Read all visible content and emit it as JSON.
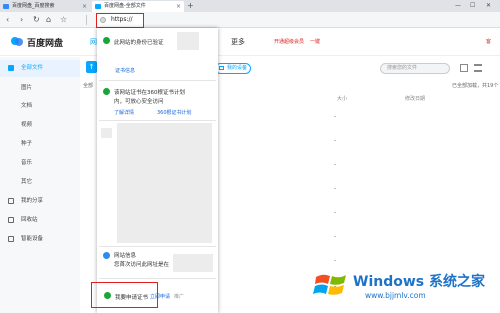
{
  "browser": {
    "tabs": [
      {
        "label": "百度网盘_百度搜索"
      },
      {
        "label": "百度网盘-全部文件"
      }
    ],
    "new_tab": "+",
    "address": "https://",
    "nav": {
      "back": "‹",
      "forward": "›",
      "refresh": "↻",
      "home": "⌂",
      "star": "☆"
    },
    "window_controls": {
      "minimize": "—",
      "maximize": "☐",
      "close": "✕"
    }
  },
  "app": {
    "logo_text": "百度网盘",
    "nav_first": "网",
    "nav_more": "更多",
    "promo": "开通超级会员",
    "promo2": "一键",
    "promo3": "客"
  },
  "sidebar": {
    "items": [
      {
        "label": "全部文件",
        "active": true
      },
      {
        "label": "图片"
      },
      {
        "label": "文档"
      },
      {
        "label": "视频"
      },
      {
        "label": "种子"
      },
      {
        "label": "音乐"
      },
      {
        "label": "其它"
      },
      {
        "label": "我的分享"
      },
      {
        "label": "回收站"
      },
      {
        "label": "智能设备"
      }
    ]
  },
  "toolbar": {
    "devices": "我的设备",
    "search_placeholder": "搜索您的文件",
    "file_all": "全部",
    "loaded": "已全部加载，共19个"
  },
  "table": {
    "headers": {
      "size": "大小",
      "modified": "修改日期"
    },
    "dash": "-"
  },
  "popup": {
    "verified": "此网站的身份已验证",
    "cert_info": "证书信息",
    "plan": "该网站证书在360根证书计划内，可放心安全访问",
    "learn_more": "了解详情",
    "root_plan": "360根证书计划",
    "site_info": "网站信息",
    "first_visit": "您首次访问此网址是在",
    "apply": "我要申请证书",
    "apply_link": "立即申请",
    "apply_hint": "推广"
  },
  "watermark": {
    "title": "Windows 系统之家",
    "url": "www.bjjmlv.com"
  }
}
